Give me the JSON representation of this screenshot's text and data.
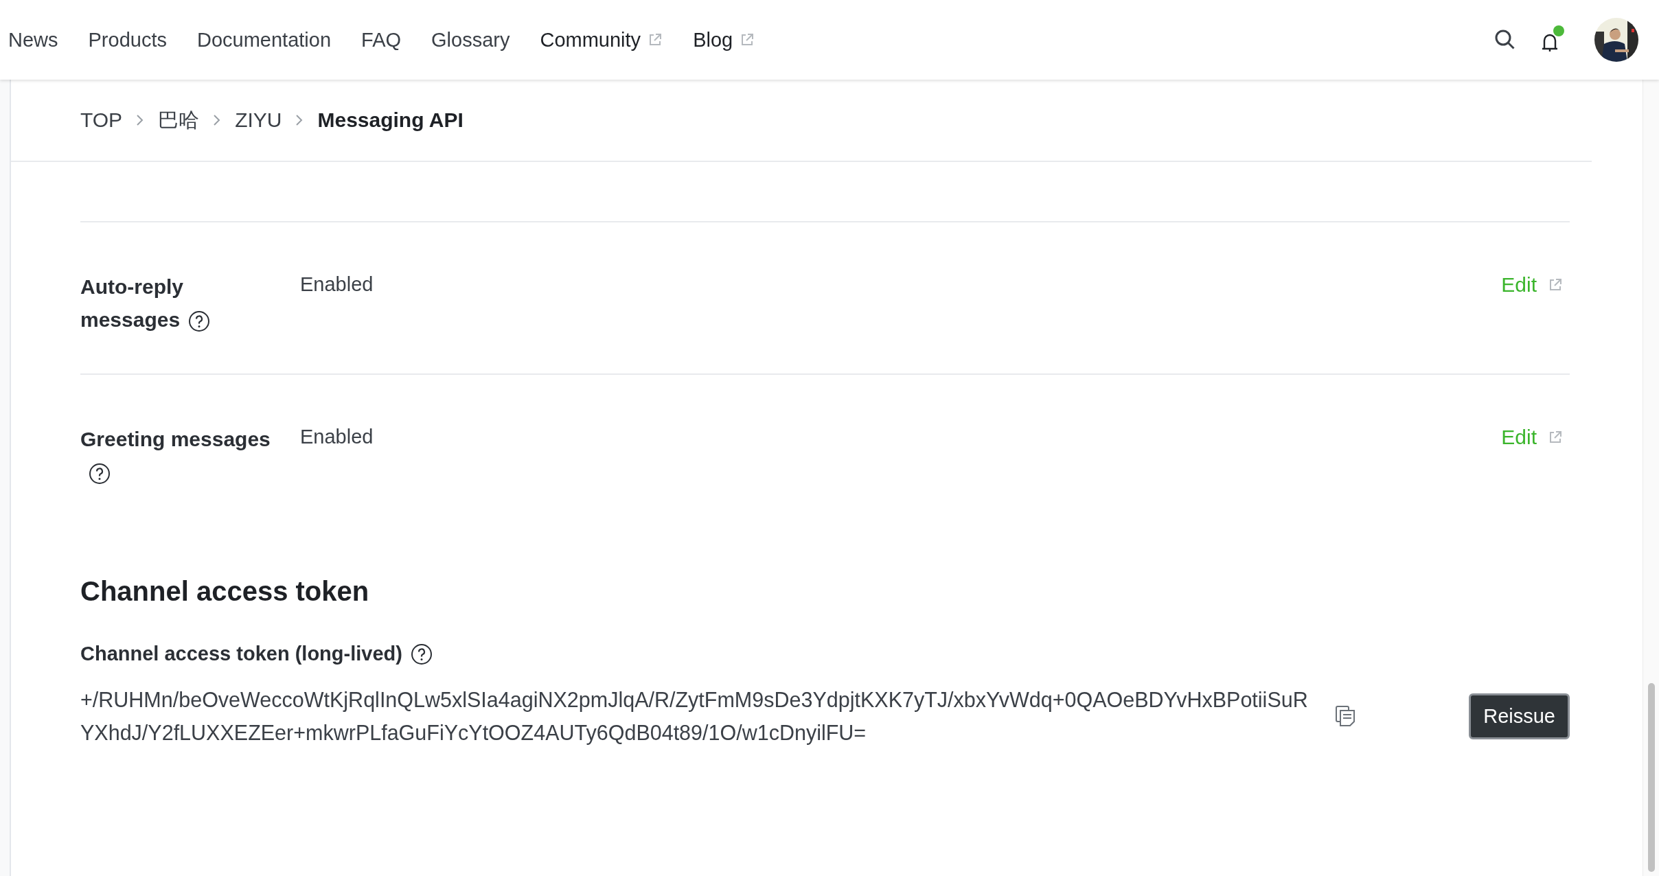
{
  "nav": {
    "items": [
      {
        "label": "News",
        "external": false
      },
      {
        "label": "Products",
        "external": false
      },
      {
        "label": "Documentation",
        "external": false
      },
      {
        "label": "FAQ",
        "external": false
      },
      {
        "label": "Glossary",
        "external": false
      },
      {
        "label": "Community",
        "external": true
      },
      {
        "label": "Blog",
        "external": true
      }
    ],
    "notifications": {
      "unread": true
    }
  },
  "breadcrumb": [
    "TOP",
    "巴哈",
    "ZIYU",
    "Messaging API"
  ],
  "settings": [
    {
      "label": "Auto-reply messages",
      "value": "Enabled",
      "action": "Edit"
    },
    {
      "label": "Greeting messages",
      "value": "Enabled",
      "action": "Edit"
    }
  ],
  "token_section": {
    "title": "Channel access token",
    "field_label": "Channel access token (long-lived)",
    "token": "+/RUHMn/beOveWeccoWtKjRqlInQLw5xlSIa4agiNX2pmJlqA/R/ZytFmM9sDe3YdpjtKXK7yTJ/xbxYvWdq+0QAOeBDYvHxBPotiiSuRYXhdJ/Y2fLUXXEZEer+mkwrPLfaGuFiYcYtOOZ4AUTy6QdB04t89/1O/w1cDnyilFU=",
    "button": "Reissue"
  }
}
